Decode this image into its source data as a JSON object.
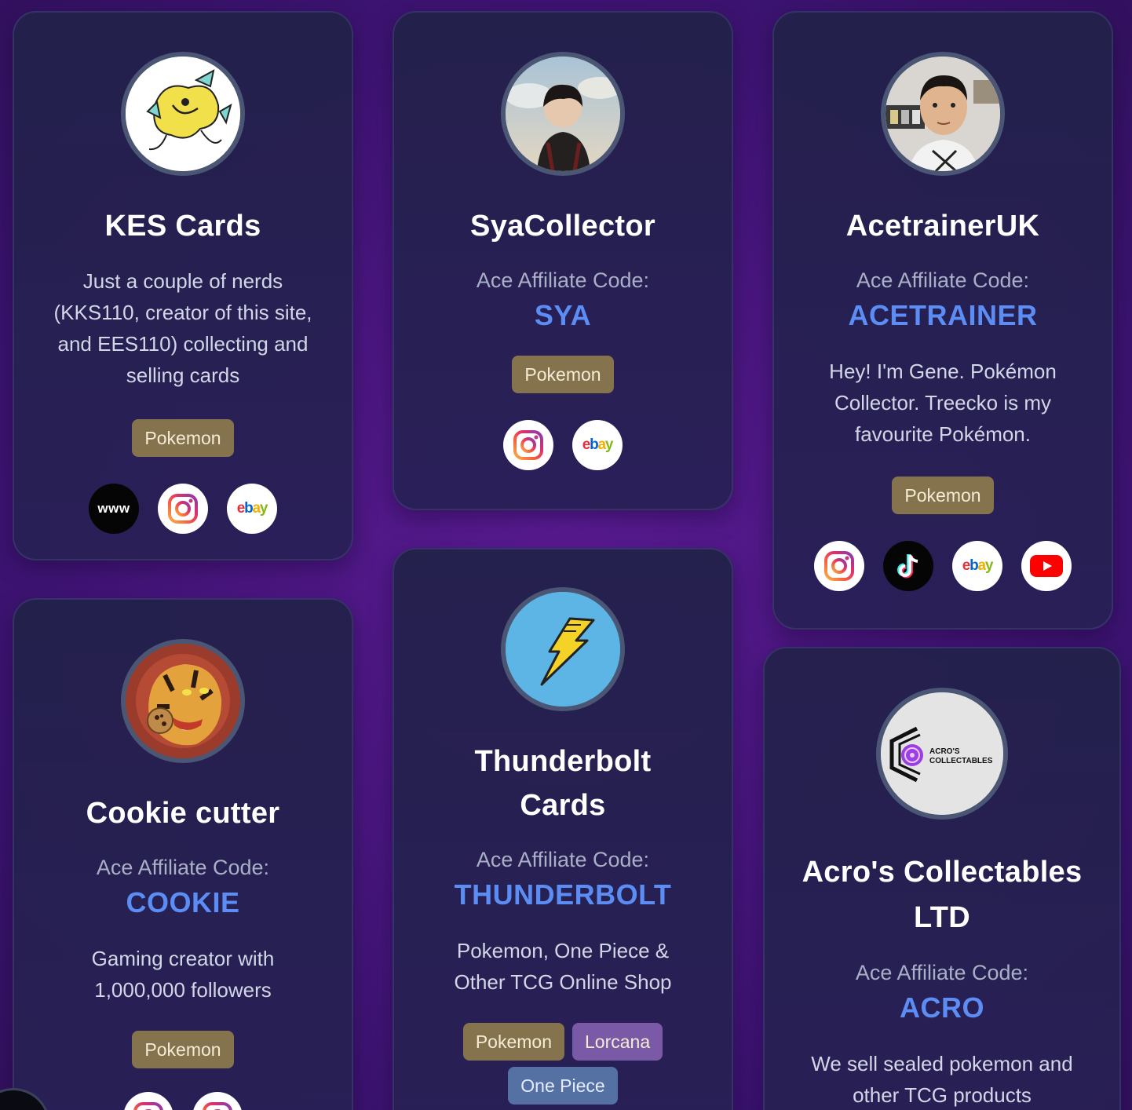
{
  "cards": [
    {
      "name": "KES Cards",
      "code_label": "",
      "code": "",
      "description": "Just a couple of nerds (KKS110, creator of this site, and EES110) collecting and selling cards",
      "tags": [
        "Pokemon"
      ],
      "socials": [
        "website-icon",
        "instagram-icon",
        "ebay-icon"
      ]
    },
    {
      "name": "SyaCollector",
      "code_label": "Ace Affiliate Code:",
      "code": "SYA",
      "description": "",
      "tags": [
        "Pokemon"
      ],
      "socials": [
        "instagram-icon",
        "ebay-icon"
      ]
    },
    {
      "name": "AcetrainerUK",
      "code_label": "Ace Affiliate Code:",
      "code": "ACETRAINER",
      "description": "Hey! I'm Gene. Pokémon Collector. Treecko is my favourite Pokémon.",
      "tags": [
        "Pokemon"
      ],
      "socials": [
        "instagram-icon",
        "tiktok-icon",
        "ebay-icon",
        "youtube-icon"
      ]
    },
    {
      "name": "Cookie cutter",
      "code_label": "Ace Affiliate Code:",
      "code": "COOKIE",
      "description": "Gaming creator with 1,000,000 followers",
      "tags": [
        "Pokemon"
      ],
      "socials": [
        "instagram-icon",
        "instagram-icon"
      ]
    },
    {
      "name": "Thunderbolt Cards",
      "code_label": "Ace Affiliate Code:",
      "code": "THUNDERBOLT",
      "description": "Pokemon, One Piece & Other TCG Online Shop",
      "tags": [
        "Pokemon",
        "Lorcana",
        "One Piece"
      ],
      "socials": []
    },
    {
      "name": "Acro's Collectables LTD",
      "code_label": "Ace Affiliate Code:",
      "code": "ACRO",
      "description": "We sell sealed pokemon and other TCG products",
      "tags": [],
      "socials": [],
      "logo_text": [
        "ACRO'S",
        "COLLECTABLES"
      ]
    }
  ],
  "website_icon_text": "www",
  "ebay_letters": [
    "e",
    "b",
    "a",
    "y"
  ],
  "colors": {
    "accent_code": "#5b8df5",
    "tag_pokemon": "#85734e",
    "tag_lorcana": "#7a5aa6",
    "tag_onepiece": "#5571a4"
  }
}
